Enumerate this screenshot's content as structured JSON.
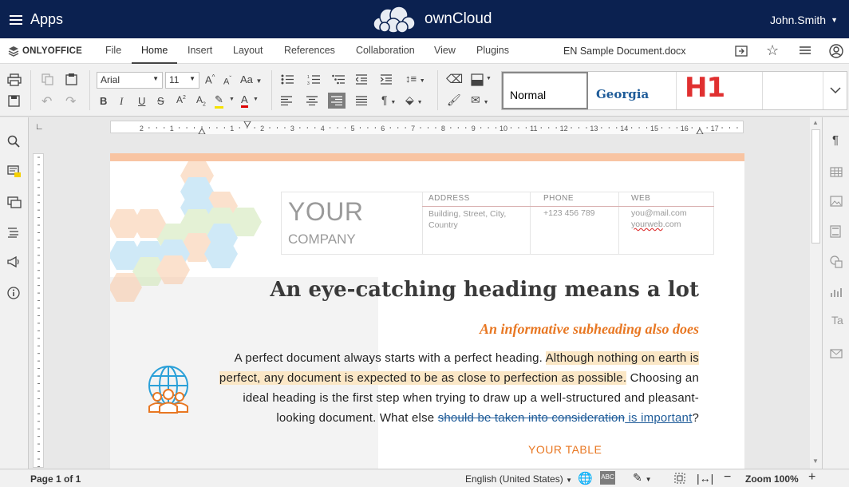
{
  "header": {
    "apps_label": "Apps",
    "brand": "ownCloud",
    "user": "John.Smith"
  },
  "menubar": {
    "logo": "ONLYOFFICE",
    "tabs": [
      "File",
      "Home",
      "Insert",
      "Layout",
      "References",
      "Collaboration",
      "View",
      "Plugins"
    ],
    "active_tab": "Home",
    "document_name": "EN Sample Document.docx"
  },
  "toolbar": {
    "font_name": "Arial",
    "font_size": "11",
    "styles": [
      "Normal",
      "Georgia",
      "H1"
    ]
  },
  "document": {
    "company_line1": "YOUR",
    "company_line2": "COMPANY",
    "address_label": "ADDRESS",
    "address_value": "Building, Street, City, Country",
    "phone_label": "PHONE",
    "phone_value": "+123 456 789",
    "web_label": "WEB",
    "web_email": "you@mail.com",
    "web_site_a": "yourweb",
    "web_site_b": ".com",
    "heading": "An eye-catching heading means a lot",
    "subheading": "An informative subheading also does",
    "para_a": "A perfect document always starts with a perfect heading. ",
    "para_hl": "Although nothing on earth is perfect, any document is expected to be as close to perfection as possible.",
    "para_b": " Choosing an ideal heading is the first step when trying to draw up a well-structured and pleasant-looking document. What else ",
    "para_strike": "should be taken into consideration",
    "para_insert": " is important",
    "para_end": "?",
    "table_title": "YOUR TABLE"
  },
  "statusbar": {
    "page": "Page 1 of 1",
    "language": "English (United States)",
    "zoom": "Zoom 100%"
  },
  "ruler": {
    "h_marks": [
      "2",
      "1",
      "1",
      "2",
      "3",
      "4",
      "5",
      "6",
      "7",
      "8",
      "9",
      "10",
      "11",
      "12",
      "13",
      "14",
      "15",
      "16",
      "17"
    ]
  },
  "colors": {
    "header_bg": "#0b2150",
    "accent_orange": "#e87722",
    "peach_band": "#f8c4a2",
    "track_blue": "#1f5c99"
  }
}
